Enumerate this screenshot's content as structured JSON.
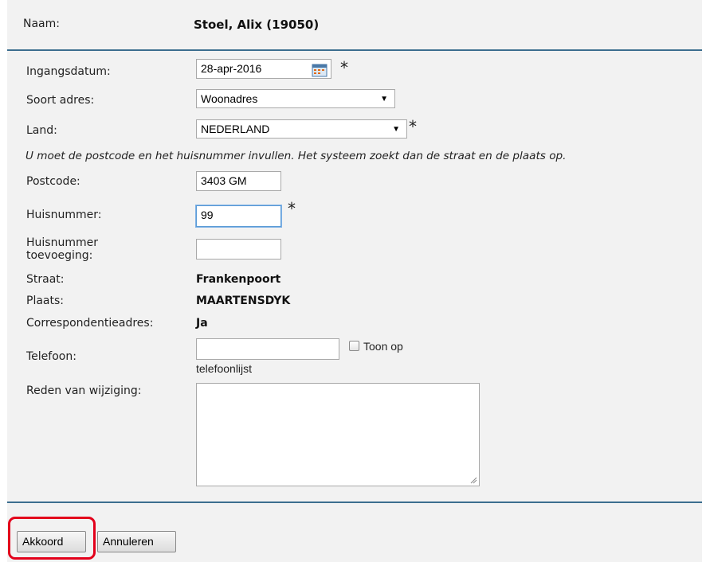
{
  "header": {
    "name_label": "Naam:",
    "name_value": "Stoel, Alix (19050)"
  },
  "form": {
    "ingangsdatum": {
      "label": "Ingangsdatum:",
      "value": "28-apr-2016",
      "required": "*"
    },
    "soort_adres": {
      "label": "Soort adres:",
      "value": "Woonadres"
    },
    "land": {
      "label": "Land:",
      "value": "NEDERLAND",
      "required": "*"
    },
    "notice": "U moet de postcode en het huisnummer invullen. Het systeem zoekt dan de straat en de plaats op.",
    "postcode": {
      "label": "Postcode:",
      "value": "3403 GM"
    },
    "huisnummer": {
      "label": "Huisnummer:",
      "value": "99",
      "required": "*"
    },
    "toevoeging": {
      "label_line1": "Huisnummer",
      "label_line2": "toevoeging:",
      "value": ""
    },
    "straat": {
      "label": "Straat:",
      "value": "Frankenpoort"
    },
    "plaats": {
      "label": "Plaats:",
      "value": "MAARTENSDYK"
    },
    "correspondentie": {
      "label": "Correspondentieadres:",
      "value": "Ja"
    },
    "telefoon": {
      "label": "Telefoon:",
      "value": "",
      "checkbox_label_line1": "Toon op",
      "checkbox_label_line2": "telefoonlijst"
    },
    "reden": {
      "label": "Reden van wijziging:",
      "value": ""
    }
  },
  "buttons": {
    "akkoord": "Akkoord",
    "annuleren": "Annuleren"
  },
  "icons": {
    "calendar": "calendar-icon",
    "resize": "resize-grip-icon"
  },
  "colors": {
    "rule": "#3c6e8f",
    "highlight": "#e3001b",
    "panel": "#f2f2f2"
  }
}
